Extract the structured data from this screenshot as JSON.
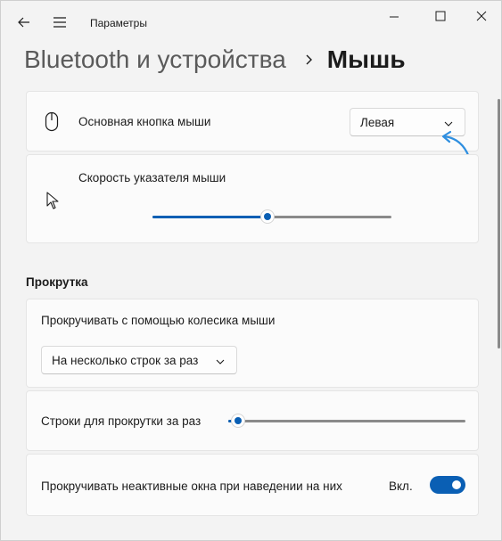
{
  "window": {
    "title": "Параметры"
  },
  "header": {
    "parent": "Bluetooth и устройства",
    "current": "Мышь"
  },
  "primary_button": {
    "label": "Основная кнопка мыши",
    "value": "Левая"
  },
  "pointer_speed": {
    "label": "Скорость указателя мыши",
    "level": 0.48
  },
  "scrolling": {
    "section_title": "Прокрутка",
    "wheel_label": "Прокручивать с помощью колесика мыши",
    "wheel_value": "На несколько строк за раз",
    "lines_label": "Строки для прокрутки за раз",
    "lines_level": 0.04,
    "inactive_label": "Прокручивать неактивные окна при наведении на них",
    "inactive_state": "Вкл."
  },
  "colors": {
    "accent": "#0a5fb4",
    "annotation": "#2f8fe0"
  },
  "icons": [
    "back-arrow-icon",
    "hamburger-menu-icon",
    "minimize-icon",
    "maximize-icon",
    "close-icon",
    "chevron-right-icon",
    "mouse-icon",
    "pointer-icon",
    "chevron-down-icon"
  ]
}
